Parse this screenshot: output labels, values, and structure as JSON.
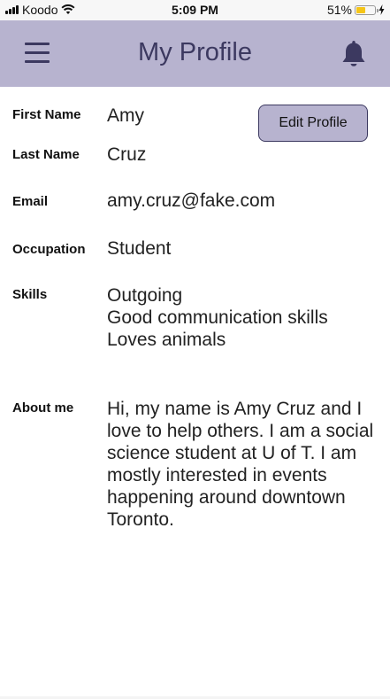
{
  "status_bar": {
    "carrier": "Koodo",
    "time": "5:09 PM",
    "battery_percent": "51%",
    "battery_level": 0.51,
    "icons": [
      "signal-icon",
      "wifi-icon",
      "battery-icon",
      "charging-icon"
    ]
  },
  "header": {
    "title": "My Profile",
    "menu_icon": "hamburger-menu-icon",
    "notification_icon": "bell-icon",
    "background_color": "#b7b3cf",
    "accent_color": "#3c3960"
  },
  "profile": {
    "edit_button_label": "Edit Profile",
    "first_name": {
      "label": "First Name",
      "value": "Amy"
    },
    "last_name": {
      "label": "Last Name",
      "value": "Cruz"
    },
    "email": {
      "label": "Email",
      "value": "amy.cruz@fake.com"
    },
    "occupation": {
      "label": "Occupation",
      "value": "Student"
    },
    "skills": {
      "label": "Skills",
      "value": "Outgoing\nGood communication skills\nLoves animals"
    },
    "about_me": {
      "label": "About me",
      "value": "Hi, my name is Amy Cruz and I love to help others.  I am a social science student at U of T. I am mostly interested in events happening around downtown Toronto."
    }
  }
}
